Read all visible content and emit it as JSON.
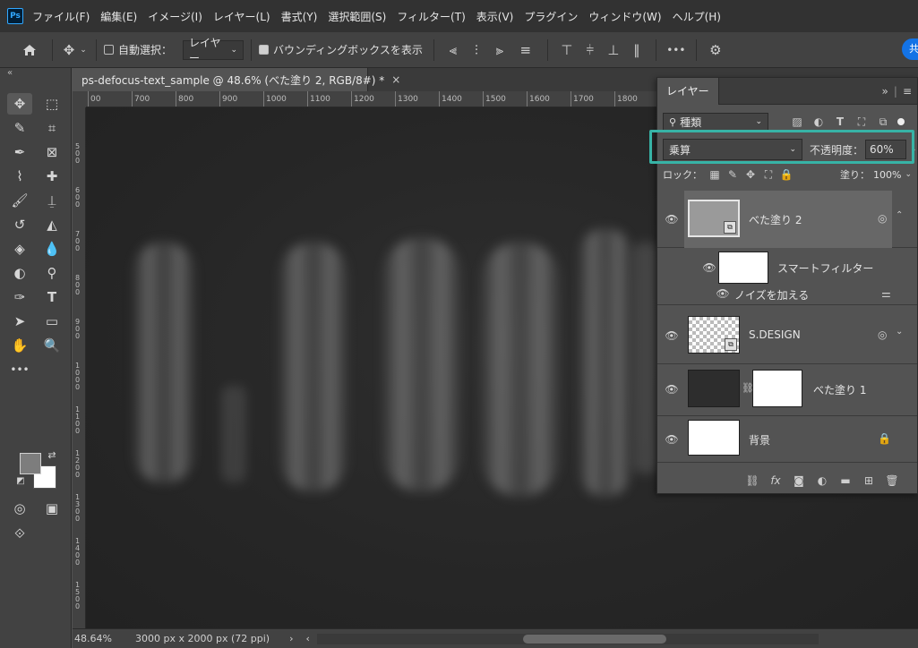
{
  "app": {
    "logo": "Ps"
  },
  "menu": [
    "ファイル(F)",
    "編集(E)",
    "イメージ(I)",
    "レイヤー(L)",
    "書式(Y)",
    "選択範囲(S)",
    "フィルター(T)",
    "表示(V)",
    "プラグイン",
    "ウィンドウ(W)",
    "ヘルプ(H)"
  ],
  "options": {
    "auto_select_label": "自動選択：",
    "auto_select_target": "レイヤー",
    "bounding_box_label": "バウンディングボックスを表示",
    "more": "•••",
    "share_label": "共"
  },
  "document": {
    "tab_title": "ps-defocus-text_sample @ 48.6% (べた塗り 2, RGB/8#) *",
    "close": "×",
    "zoom": "48.64%",
    "size_info": "3000 px x 2000 px (72 ppi)"
  },
  "ruler": {
    "top": [
      "00",
      "700",
      "800",
      "900",
      "1000",
      "1100",
      "1200",
      "1300",
      "1400",
      "1500",
      "1600",
      "1700",
      "1800"
    ],
    "left": [
      "5\n0\n0",
      "6\n0\n0",
      "7\n0\n0",
      "8\n0\n0",
      "9\n0\n0",
      "1\n0\n0\n0",
      "1\n1\n0\n0",
      "1\n2\n0\n0",
      "1\n3\n0\n0",
      "1\n4\n0\n0",
      "1\n5\n0\n0"
    ]
  },
  "layers_panel": {
    "tab": "レイヤー",
    "filter_kind": "種類",
    "blend_mode": "乗算",
    "opacity_label": "不透明度：",
    "opacity_value": "60%",
    "lock_label": "ロック：",
    "fill_label": "塗り：",
    "fill_value": "100%",
    "layers": [
      {
        "name": "べた塗り 2",
        "type": "fill",
        "selected": true
      },
      {
        "name": "スマートフィルター",
        "type": "smart-filter"
      },
      {
        "name": "ノイズを加える",
        "type": "filter-effect"
      },
      {
        "name": "S.DESIGN",
        "type": "smart-object"
      },
      {
        "name": "べた塗り 1",
        "type": "fill"
      },
      {
        "name": "背景",
        "type": "background",
        "locked": true
      }
    ],
    "bottom_icons": [
      "link-icon",
      "fx-icon",
      "mask-icon",
      "adjustment-icon",
      "folder-icon",
      "new-layer-icon",
      "trash-icon"
    ],
    "fx_label": "fx"
  },
  "colors": {
    "highlight": "#37b3a6",
    "accent": "#1473e6"
  }
}
